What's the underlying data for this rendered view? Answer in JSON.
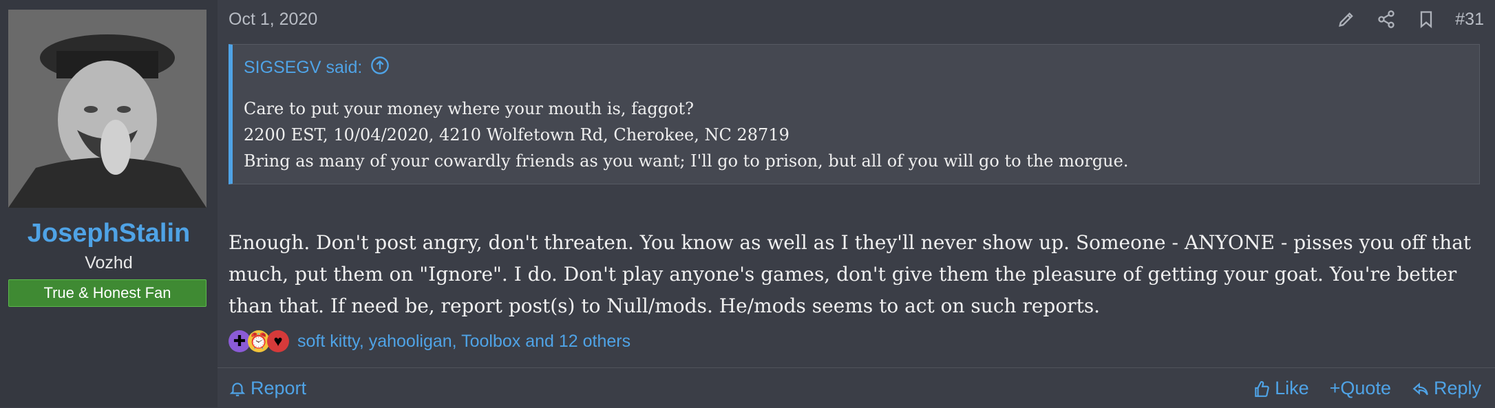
{
  "user": {
    "name": "JosephStalin",
    "title": "Vozhd",
    "banner": "True & Honest Fan"
  },
  "post": {
    "date": "Oct 1, 2020",
    "number": "#31",
    "icons": [
      "edit-icon",
      "share-icon",
      "bookmark-icon"
    ],
    "quote": {
      "author_said": "SIGSEGV said:",
      "lines": [
        "Care to put your money where your mouth is, faggot?",
        "2200 EST, 10/04/2020, 4210 Wolfetown Rd, Cherokee, NC 28719",
        "Bring as many of your cowardly friends as you want; I'll go to prison, but all of you will go to the morgue."
      ]
    },
    "body": "Enough. Don't post angry, don't threaten. You know as well as I they'll never show up. Someone - ANYONE - pisses you off that much, put them on \"Ignore\". I do. Don't play anyone's games, don't give them the pleasure of getting your goat. You're better than that. If need be, report post(s) to Null/mods. He/mods seems to act on such reports.",
    "reactions": {
      "icons": [
        "puzzle-icon",
        "alarm-clock-icon",
        "heart-icon"
      ],
      "text": "soft kitty, yahooligan, Toolbox and 12 others"
    }
  },
  "footer": {
    "report": "Report",
    "like": "Like",
    "quote": "+Quote",
    "reply": "Reply"
  },
  "colors": {
    "accent": "#4fa3e6",
    "banner": "#3f8a33",
    "background": "#3b3e47"
  }
}
